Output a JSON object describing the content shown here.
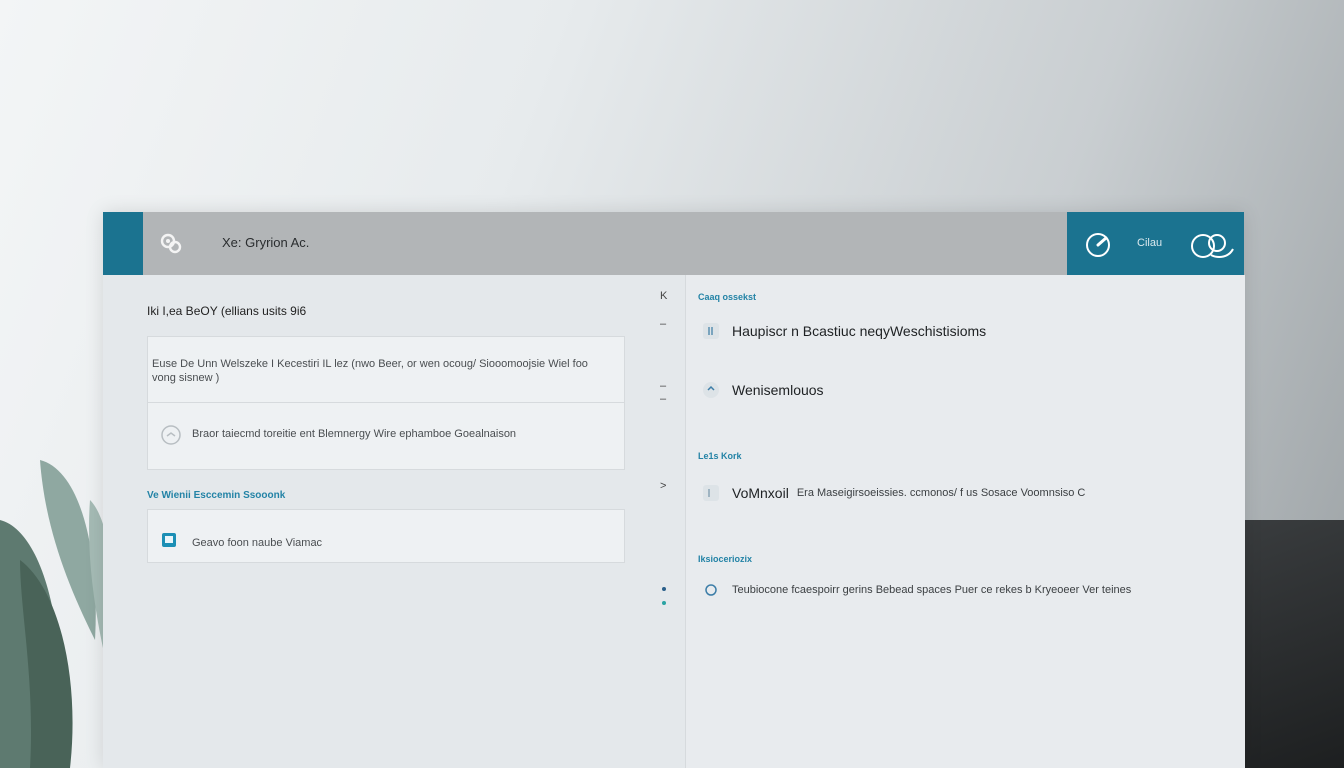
{
  "window": {
    "title": "Xe: Gryrion Ac.",
    "user_label": "Cilau"
  },
  "left": {
    "section_title": "Iki I,ea BeOY (ellians usits 9i6",
    "card_1_text": "Euse De Unn Welszeke I Kecestiri IL lez (nwo Beer, or wen ocoug/ Siooomoojsie Wiel foo vong sisnew )",
    "card_2_text": "Braor taiecmd toreitie ent Blemnergy Wire ephamboe Goealnaison",
    "group_label": "Ve Wienii Esccemin Ssooonk",
    "card_3_text": "Geavo foon naube Viamac"
  },
  "gutter": {
    "mark_1": "K",
    "mark_2": "–",
    "mark_3": "–",
    "mark_4": "–",
    "mark_5": "˃"
  },
  "right": {
    "label_1": "Caaq ossekst",
    "row_1_main": "Haupiscr n Bcastiuc neqyWeschistisioms",
    "row_2_main": "Wenisemlouos",
    "label_2": "Le1s Kork",
    "row_3_main": "VoMnxoil",
    "row_3_sub": "Era Maseigirsoeissies. ccmonos/ f us Sosace Voomnsiso C",
    "label_3": "Iksioceriozix",
    "row_4_sub": "Teubiocone fcaespoirr gerins Bebead spaces Puer ce rekes b Kryeoeer Ver teines"
  },
  "colors": {
    "accent": "#1b7390",
    "label_blue": "#2383a6"
  },
  "icons": {
    "app": "gear-cluster-icon",
    "user": "user-avatar-icon",
    "headset": "headset-icon",
    "item": "circle-item-icon",
    "book": "book-icon"
  }
}
